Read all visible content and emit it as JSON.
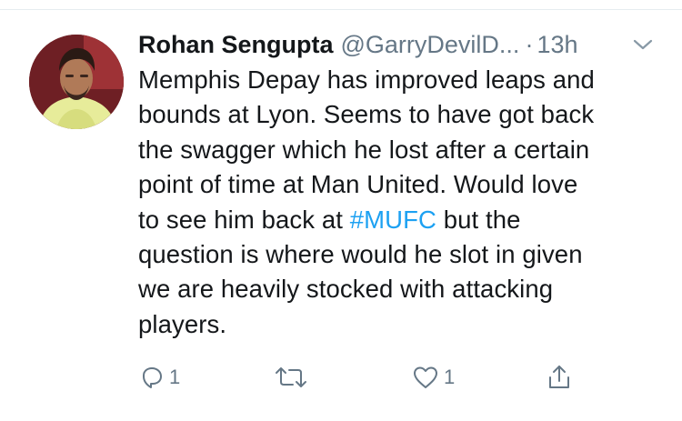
{
  "tweet": {
    "author_name": "Rohan Sengupta",
    "author_handle": "@GarryDevilD...",
    "separator": "·",
    "timestamp": "13h",
    "text_lines": [
      "Memphis Depay has improved leaps and",
      "bounds at Lyon. Seems to have got back",
      "the swagger which he lost after a certain",
      "point of time at Man United. Would love"
    ],
    "line5_before": "to see him back at ",
    "hashtag": "#MUFC",
    "line5_after": " but the",
    "text_lines_tail": [
      "question is where would he slot in given",
      "we are heavily stocked with attacking",
      "players."
    ],
    "reply_count": "1",
    "like_count": "1"
  },
  "icons": {
    "reply": "reply-icon",
    "retweet": "retweet-icon",
    "like": "heart-icon",
    "share": "share-icon",
    "menu": "chevron-down-icon"
  },
  "colors": {
    "text": "#14171a",
    "muted": "#657786",
    "link": "#1da1f2",
    "divider": "#e6ecf0"
  }
}
